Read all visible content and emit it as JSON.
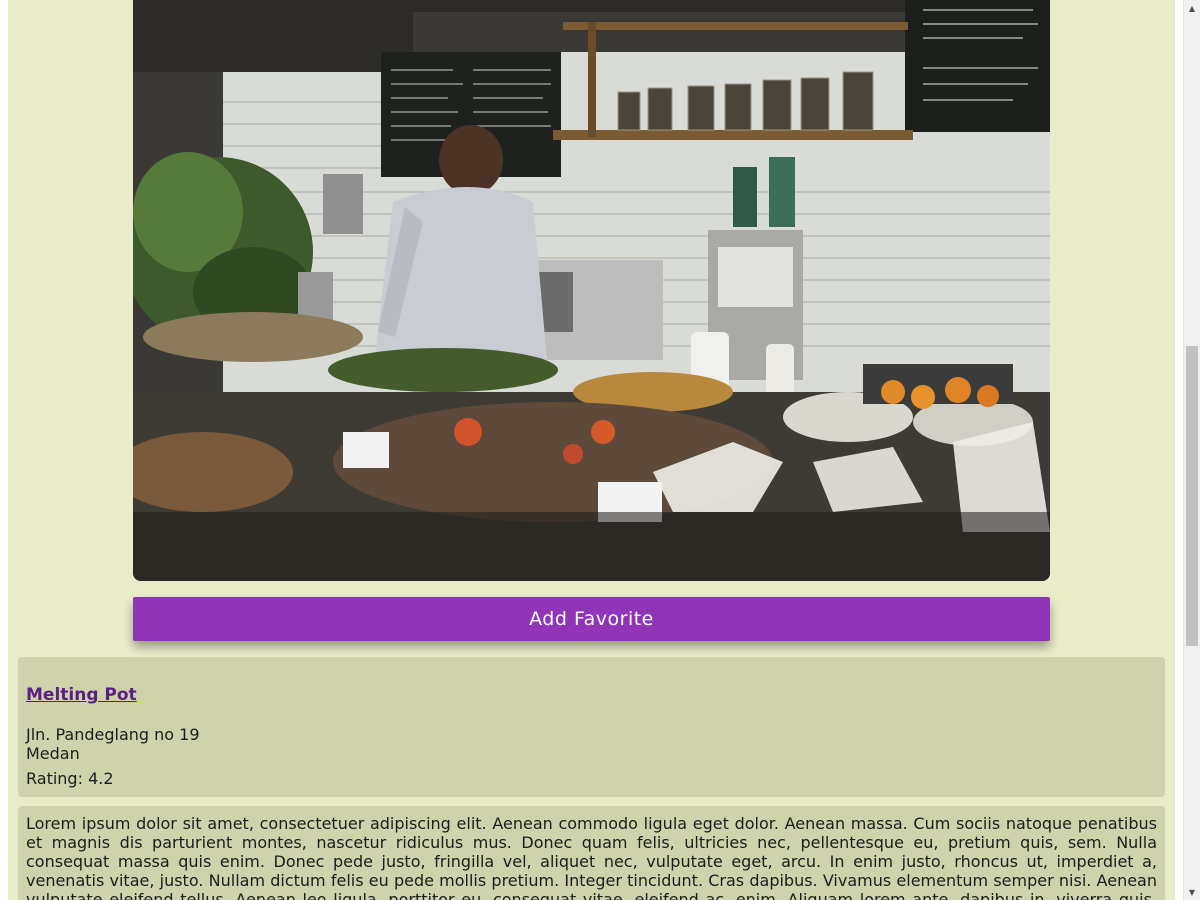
{
  "hero": {
    "image_alt": "Restaurant counter with food and a barista at an espresso machine"
  },
  "actions": {
    "favorite_label": "Add Favorite"
  },
  "restaurant": {
    "name": "Melting Pot",
    "address": "Jln. Pandeglang no 19",
    "city": "Medan",
    "rating": "Rating: 4.2"
  },
  "description": "Lorem ipsum dolor sit amet, consectetuer adipiscing elit. Aenean commodo ligula eget dolor. Aenean massa. Cum sociis natoque penatibus et magnis dis parturient montes, nascetur ridiculus mus. Donec quam felis, ultricies nec, pellentesque eu, pretium quis, sem. Nulla consequat massa quis enim. Donec pede justo, fringilla vel, aliquet nec, vulputate eget, arcu. In enim justo, rhoncus ut, imperdiet a, venenatis vitae, justo. Nullam dictum felis eu pede mollis pretium. Integer tincidunt. Cras dapibus. Vivamus elementum semper nisi. Aenean vulputate eleifend tellus. Aenean leo ligula, porttitor eu, consequat vitae, eleifend ac, enim. Aliquam lorem ante, dapibus in, viverra quis, feugiat a, tellus.",
  "colors": {
    "page_background": "#e9ecc9",
    "card_background": "#cfd3ac",
    "button_background": "#9135b8",
    "link_color": "#5a1f86"
  },
  "icons": {
    "scroll_up": "scroll-up-arrow-icon",
    "scroll_down": "scroll-down-arrow-icon"
  }
}
